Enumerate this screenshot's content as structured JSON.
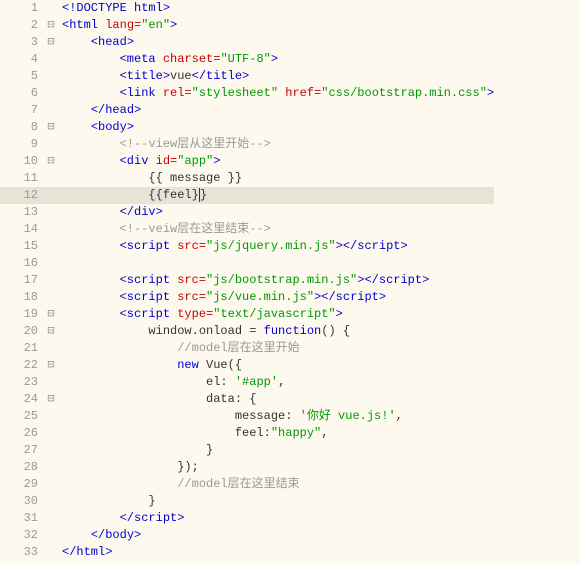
{
  "gutter": {
    "fold_marker": "⊟",
    "highlight_line": 12
  },
  "lines": [
    {
      "n": "1",
      "f": "",
      "indent": "",
      "segs": [
        {
          "t": "<!DOCTYPE html>",
          "c": "tag"
        }
      ]
    },
    {
      "n": "2",
      "f": "⊟",
      "indent": "",
      "segs": [
        {
          "t": "<html ",
          "c": "tag"
        },
        {
          "t": "lang=",
          "c": "attr"
        },
        {
          "t": "\"en\"",
          "c": "str"
        },
        {
          "t": ">",
          "c": "tag"
        }
      ]
    },
    {
      "n": "3",
      "f": "⊟",
      "indent": "    ",
      "segs": [
        {
          "t": "<head>",
          "c": "tag"
        }
      ]
    },
    {
      "n": "4",
      "f": "",
      "indent": "        ",
      "segs": [
        {
          "t": "<meta ",
          "c": "tag"
        },
        {
          "t": "charset=",
          "c": "attr"
        },
        {
          "t": "\"UTF-8\"",
          "c": "str"
        },
        {
          "t": ">",
          "c": "tag"
        }
      ]
    },
    {
      "n": "5",
      "f": "",
      "indent": "        ",
      "segs": [
        {
          "t": "<title>",
          "c": "tag"
        },
        {
          "t": "vue",
          "c": "txt"
        },
        {
          "t": "</title>",
          "c": "tag"
        }
      ]
    },
    {
      "n": "6",
      "f": "",
      "indent": "        ",
      "segs": [
        {
          "t": "<link ",
          "c": "tag"
        },
        {
          "t": "rel=",
          "c": "attr"
        },
        {
          "t": "\"stylesheet\"",
          "c": "str"
        },
        {
          "t": " ",
          "c": "txt"
        },
        {
          "t": "href=",
          "c": "attr"
        },
        {
          "t": "\"css/bootstrap.min.css\"",
          "c": "str"
        },
        {
          "t": ">",
          "c": "tag"
        }
      ]
    },
    {
      "n": "7",
      "f": "",
      "indent": "    ",
      "segs": [
        {
          "t": "</head>",
          "c": "tag"
        }
      ]
    },
    {
      "n": "8",
      "f": "⊟",
      "indent": "    ",
      "segs": [
        {
          "t": "<body>",
          "c": "tag"
        }
      ]
    },
    {
      "n": "9",
      "f": "",
      "indent": "        ",
      "segs": [
        {
          "t": "<!--view层从这里开始-->",
          "c": "cmt"
        }
      ]
    },
    {
      "n": "10",
      "f": "⊟",
      "indent": "        ",
      "segs": [
        {
          "t": "<div ",
          "c": "tag"
        },
        {
          "t": "id=",
          "c": "attr"
        },
        {
          "t": "\"app\"",
          "c": "str"
        },
        {
          "t": ">",
          "c": "tag"
        }
      ]
    },
    {
      "n": "11",
      "f": "",
      "indent": "            ",
      "segs": [
        {
          "t": "{{ message }}",
          "c": "txt"
        }
      ]
    },
    {
      "n": "12",
      "f": "",
      "indent": "            ",
      "segs": [
        {
          "t": "{{feel}",
          "c": "txt"
        },
        {
          "t": "|",
          "c": "cursor"
        },
        {
          "t": "}",
          "c": "txt"
        }
      ]
    },
    {
      "n": "13",
      "f": "",
      "indent": "        ",
      "segs": [
        {
          "t": "</div>",
          "c": "tag"
        }
      ]
    },
    {
      "n": "14",
      "f": "",
      "indent": "        ",
      "segs": [
        {
          "t": "<!--veiw层在这里结束-->",
          "c": "cmt"
        }
      ]
    },
    {
      "n": "15",
      "f": "",
      "indent": "        ",
      "segs": [
        {
          "t": "<script ",
          "c": "tag"
        },
        {
          "t": "src=",
          "c": "attr"
        },
        {
          "t": "\"js/jquery.min.js\"",
          "c": "str"
        },
        {
          "t": "></script>",
          "c": "tag"
        }
      ]
    },
    {
      "n": "16",
      "f": "",
      "indent": "",
      "segs": []
    },
    {
      "n": "17",
      "f": "",
      "indent": "        ",
      "segs": [
        {
          "t": "<script ",
          "c": "tag"
        },
        {
          "t": "src=",
          "c": "attr"
        },
        {
          "t": "\"js/bootstrap.min.js\"",
          "c": "str"
        },
        {
          "t": "></script>",
          "c": "tag"
        }
      ]
    },
    {
      "n": "18",
      "f": "",
      "indent": "        ",
      "segs": [
        {
          "t": "<script ",
          "c": "tag"
        },
        {
          "t": "src=",
          "c": "attr"
        },
        {
          "t": "\"js/vue.min.js\"",
          "c": "str"
        },
        {
          "t": "></script>",
          "c": "tag"
        }
      ]
    },
    {
      "n": "19",
      "f": "⊟",
      "indent": "        ",
      "segs": [
        {
          "t": "<script ",
          "c": "tag"
        },
        {
          "t": "type=",
          "c": "attr"
        },
        {
          "t": "\"text/javascript\"",
          "c": "str"
        },
        {
          "t": ">",
          "c": "tag"
        }
      ]
    },
    {
      "n": "20",
      "f": "⊟",
      "indent": "            ",
      "segs": [
        {
          "t": "window.onload = ",
          "c": "txt"
        },
        {
          "t": "function",
          "c": "tag"
        },
        {
          "t": "() {",
          "c": "txt"
        }
      ]
    },
    {
      "n": "21",
      "f": "",
      "indent": "                ",
      "segs": [
        {
          "t": "//model层在这里开始",
          "c": "cmt"
        }
      ]
    },
    {
      "n": "22",
      "f": "⊟",
      "indent": "                ",
      "segs": [
        {
          "t": "new",
          "c": "tag"
        },
        {
          "t": " Vue({",
          "c": "txt"
        }
      ]
    },
    {
      "n": "23",
      "f": "",
      "indent": "                    ",
      "segs": [
        {
          "t": "el: ",
          "c": "txt"
        },
        {
          "t": "'#app'",
          "c": "jsstr"
        },
        {
          "t": ",",
          "c": "txt"
        }
      ]
    },
    {
      "n": "24",
      "f": "⊟",
      "indent": "                    ",
      "segs": [
        {
          "t": "data: {",
          "c": "txt"
        }
      ]
    },
    {
      "n": "25",
      "f": "",
      "indent": "                        ",
      "segs": [
        {
          "t": "message: ",
          "c": "txt"
        },
        {
          "t": "'你好 vue.js!'",
          "c": "jsstr"
        },
        {
          "t": ",",
          "c": "txt"
        }
      ]
    },
    {
      "n": "26",
      "f": "",
      "indent": "                        ",
      "segs": [
        {
          "t": "feel:",
          "c": "txt"
        },
        {
          "t": "\"happy\"",
          "c": "jsstr"
        },
        {
          "t": ",",
          "c": "txt"
        }
      ]
    },
    {
      "n": "27",
      "f": "",
      "indent": "                    ",
      "segs": [
        {
          "t": "}",
          "c": "txt"
        }
      ]
    },
    {
      "n": "28",
      "f": "",
      "indent": "                ",
      "segs": [
        {
          "t": "});",
          "c": "txt"
        }
      ]
    },
    {
      "n": "29",
      "f": "",
      "indent": "                ",
      "segs": [
        {
          "t": "//model层在这里结束",
          "c": "cmt"
        }
      ]
    },
    {
      "n": "30",
      "f": "",
      "indent": "            ",
      "segs": [
        {
          "t": "}",
          "c": "txt"
        }
      ]
    },
    {
      "n": "31",
      "f": "",
      "indent": "        ",
      "segs": [
        {
          "t": "</script>",
          "c": "tag"
        }
      ]
    },
    {
      "n": "32",
      "f": "",
      "indent": "    ",
      "segs": [
        {
          "t": "</body>",
          "c": "tag"
        }
      ]
    },
    {
      "n": "33",
      "f": "",
      "indent": "",
      "segs": [
        {
          "t": "</html>",
          "c": "tag"
        }
      ]
    }
  ]
}
